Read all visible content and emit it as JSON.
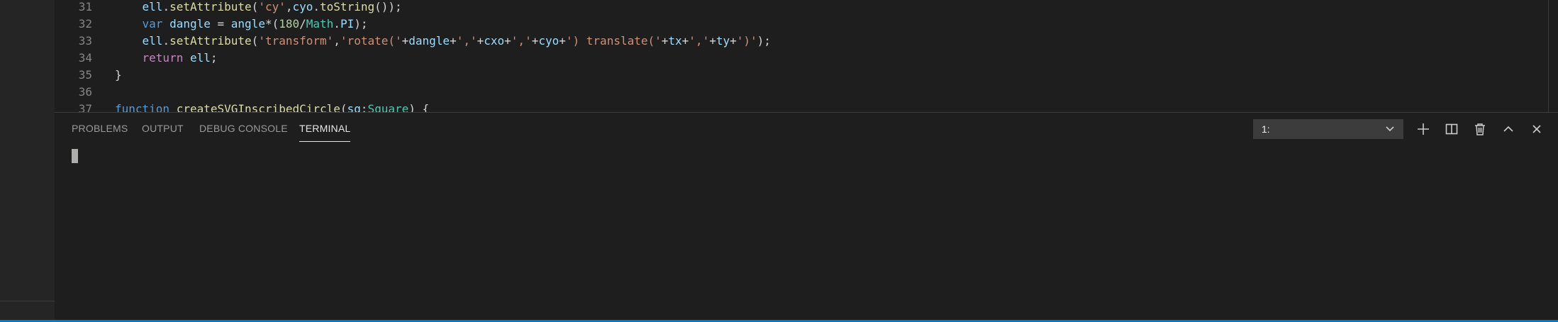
{
  "editor": {
    "lines": [
      {
        "num": "31",
        "tokens": [
          {
            "t": "    ",
            "c": "plain"
          },
          {
            "t": "ell",
            "c": "var"
          },
          {
            "t": ".",
            "c": "plain"
          },
          {
            "t": "setAttribute",
            "c": "fn"
          },
          {
            "t": "(",
            "c": "plain"
          },
          {
            "t": "'cy'",
            "c": "str"
          },
          {
            "t": ",",
            "c": "plain"
          },
          {
            "t": "cyo",
            "c": "var"
          },
          {
            "t": ".",
            "c": "plain"
          },
          {
            "t": "toString",
            "c": "fn"
          },
          {
            "t": "());",
            "c": "plain"
          }
        ]
      },
      {
        "num": "32",
        "tokens": [
          {
            "t": "    ",
            "c": "plain"
          },
          {
            "t": "var",
            "c": "kw"
          },
          {
            "t": " ",
            "c": "plain"
          },
          {
            "t": "dangle",
            "c": "var"
          },
          {
            "t": " = ",
            "c": "plain"
          },
          {
            "t": "angle",
            "c": "var"
          },
          {
            "t": "*(",
            "c": "plain"
          },
          {
            "t": "180",
            "c": "num"
          },
          {
            "t": "/",
            "c": "plain"
          },
          {
            "t": "Math",
            "c": "type"
          },
          {
            "t": ".",
            "c": "plain"
          },
          {
            "t": "PI",
            "c": "var"
          },
          {
            "t": ");",
            "c": "plain"
          }
        ]
      },
      {
        "num": "33",
        "tokens": [
          {
            "t": "    ",
            "c": "plain"
          },
          {
            "t": "ell",
            "c": "var"
          },
          {
            "t": ".",
            "c": "plain"
          },
          {
            "t": "setAttribute",
            "c": "fn"
          },
          {
            "t": "(",
            "c": "plain"
          },
          {
            "t": "'transform'",
            "c": "str"
          },
          {
            "t": ",",
            "c": "plain"
          },
          {
            "t": "'rotate('",
            "c": "str"
          },
          {
            "t": "+",
            "c": "plain"
          },
          {
            "t": "dangle",
            "c": "var"
          },
          {
            "t": "+",
            "c": "plain"
          },
          {
            "t": "','",
            "c": "str"
          },
          {
            "t": "+",
            "c": "plain"
          },
          {
            "t": "cxo",
            "c": "var"
          },
          {
            "t": "+",
            "c": "plain"
          },
          {
            "t": "','",
            "c": "str"
          },
          {
            "t": "+",
            "c": "plain"
          },
          {
            "t": "cyo",
            "c": "var"
          },
          {
            "t": "+",
            "c": "plain"
          },
          {
            "t": "') translate('",
            "c": "str"
          },
          {
            "t": "+",
            "c": "plain"
          },
          {
            "t": "tx",
            "c": "var"
          },
          {
            "t": "+",
            "c": "plain"
          },
          {
            "t": "','",
            "c": "str"
          },
          {
            "t": "+",
            "c": "plain"
          },
          {
            "t": "ty",
            "c": "var"
          },
          {
            "t": "+",
            "c": "plain"
          },
          {
            "t": "')'",
            "c": "str"
          },
          {
            "t": ");",
            "c": "plain"
          }
        ]
      },
      {
        "num": "34",
        "tokens": [
          {
            "t": "    ",
            "c": "plain"
          },
          {
            "t": "return",
            "c": "ctl"
          },
          {
            "t": " ",
            "c": "plain"
          },
          {
            "t": "ell",
            "c": "var"
          },
          {
            "t": ";",
            "c": "plain"
          }
        ]
      },
      {
        "num": "35",
        "tokens": [
          {
            "t": "}",
            "c": "plain"
          }
        ]
      },
      {
        "num": "36",
        "tokens": []
      },
      {
        "num": "37",
        "tokens": [
          {
            "t": "function",
            "c": "kw"
          },
          {
            "t": " ",
            "c": "plain"
          },
          {
            "t": "createSVGInscribedCircle",
            "c": "fn"
          },
          {
            "t": "(",
            "c": "plain"
          },
          {
            "t": "sq",
            "c": "var"
          },
          {
            "t": ":",
            "c": "plain"
          },
          {
            "t": "Square",
            "c": "type"
          },
          {
            "t": ") {",
            "c": "plain"
          }
        ]
      }
    ]
  },
  "panel": {
    "tabs": [
      {
        "label": "PROBLEMS",
        "active": false
      },
      {
        "label": "OUTPUT",
        "active": false
      },
      {
        "label": "DEBUG CONSOLE",
        "active": false
      },
      {
        "label": "TERMINAL",
        "active": true
      }
    ],
    "terminal_select": {
      "value": "1:"
    },
    "actions": [
      {
        "name": "new-terminal",
        "icon": "plus-icon"
      },
      {
        "name": "split-terminal",
        "icon": "split-icon"
      },
      {
        "name": "kill-terminal",
        "icon": "trash-icon"
      },
      {
        "name": "maximize-panel",
        "icon": "chevron-up-icon"
      },
      {
        "name": "close-panel",
        "icon": "close-icon"
      }
    ]
  },
  "colors": {
    "background": "#1e1e1e",
    "sidebar": "#252526",
    "accent": "#007acc"
  }
}
